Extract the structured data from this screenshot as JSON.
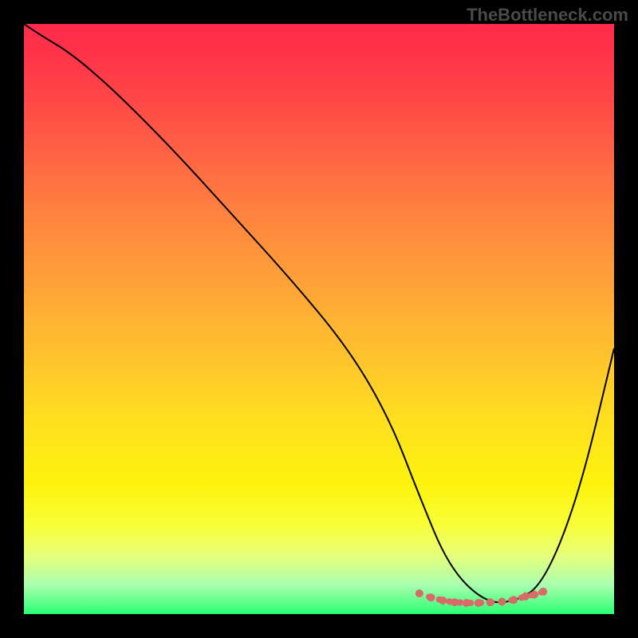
{
  "watermark": "TheBottleneck.com",
  "chart_data": {
    "type": "line",
    "title": "",
    "xlabel": "",
    "ylabel": "",
    "xlim": [
      0,
      100
    ],
    "ylim": [
      0,
      100
    ],
    "background_gradient": {
      "top": "#ff2a4a",
      "bottom": "#2bff70",
      "desc": "vertical red-to-green through orange/yellow"
    },
    "series": [
      {
        "name": "curve",
        "color": "#000000",
        "x": [
          0,
          3,
          8,
          15,
          25,
          35,
          45,
          55,
          62,
          67,
          72,
          78,
          83,
          88,
          94,
          100
        ],
        "y": [
          100,
          98,
          95,
          89,
          79,
          68,
          57,
          45,
          33,
          20,
          8,
          2,
          2,
          5,
          20,
          45
        ]
      }
    ],
    "markers": {
      "name": "valley-dots",
      "color": "#d86a6a",
      "x": [
        67,
        69,
        71,
        73,
        75,
        77,
        79,
        81,
        83,
        85,
        86.5,
        88
      ],
      "y": [
        3.5,
        2.8,
        2.3,
        2.0,
        1.9,
        1.9,
        2.0,
        2.1,
        2.4,
        3.0,
        3.3,
        3.8
      ]
    },
    "grid": false,
    "legend": false
  }
}
